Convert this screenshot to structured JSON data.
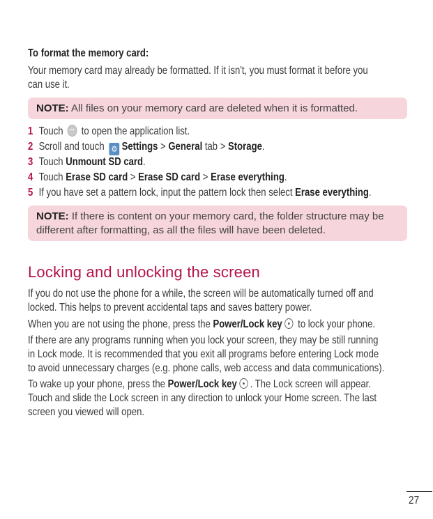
{
  "format_section": {
    "subheading": "To format the memory card:",
    "intro_line1": "Your memory card may already be formatted. If it isn't, you must format it before you",
    "intro_line2": "can use it.",
    "note1": {
      "label": "NOTE:",
      "text": " All files on your memory card are deleted when it is formatted."
    },
    "steps": [
      {
        "number": "1",
        "pre": "Touch ",
        "icon": "apps-icon",
        "post": " to open the application list."
      },
      {
        "number": "2",
        "pre": "Scroll and touch ",
        "icon": "settings-icon",
        "b1": "Settings",
        "sep1": " > ",
        "b2": "General",
        "mid": " tab > ",
        "b3": "Storage",
        "end": "."
      },
      {
        "number": "3",
        "pre": "Touch ",
        "b1": "Unmount SD card",
        "end": "."
      },
      {
        "number": "4",
        "pre": "Touch ",
        "b1": "Erase SD card",
        "sep1": " > ",
        "b2": "Erase SD card",
        "sep2": " > ",
        "b3": "Erase everything",
        "end": "."
      },
      {
        "number": "5",
        "pre": "If you have set a pattern lock, input the pattern lock then select ",
        "b1": "Erase everything",
        "end": "."
      }
    ],
    "note2": {
      "label": "NOTE:",
      "text_line1": " If there is content on your memory card, the folder structure may be",
      "text_line2": "different after formatting, as all the files will have been deleted."
    }
  },
  "lock_section": {
    "title": "Locking and unlocking the screen",
    "p1_line1": "If you do not use the phone for a while, the screen will be automatically turned off and",
    "p1_line2": "locked. This helps to prevent accidental taps and saves battery power.",
    "p2_pre": "When you are not using the phone, press the ",
    "p2_bold": "Power/Lock key",
    "p2_icon": "power-key-icon",
    "p2_post": " to lock your phone.",
    "p3_line1": "If there are any programs running when you lock your screen, they may be still running",
    "p3_line2": "in Lock mode. It is recommended that you exit all programs before entering Lock mode",
    "p3_line3": "to avoid unnecessary charges (e.g. phone calls, web access and data communications).",
    "p4_pre": "To wake up your phone, press the ",
    "p4_bold": "Power/Lock key",
    "p4_icon": "power-key-icon",
    "p4_post": ". The Lock screen will appear.",
    "p4_line2": "Touch and slide the Lock screen in any direction to unlock your Home screen. The last",
    "p4_line3": "screen you viewed will open."
  },
  "footer": {
    "page_number": "27"
  },
  "colors": {
    "accent": "#b5134b",
    "note_background": "#f6d5dc",
    "body_text": "#3a3a3a"
  }
}
